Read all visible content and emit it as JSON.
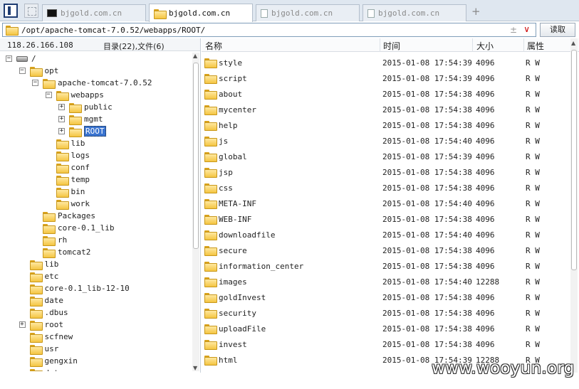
{
  "tabs": [
    {
      "label": "bjgold.com.cn",
      "icon": "terminal-icon",
      "active": false
    },
    {
      "label": "bjgold.com.cn",
      "icon": "folder-icon",
      "active": true
    },
    {
      "label": "bjgold.com.cn",
      "icon": "document-icon",
      "active": false
    },
    {
      "label": "bjgold.com.cn",
      "icon": "document-icon",
      "active": false
    }
  ],
  "new_tab_label": "+",
  "path": {
    "value": "/opt/apache-tomcat-7.0.52/webapps/ROOT/",
    "pin": "±",
    "dropdown": "∨"
  },
  "read_button": "读取",
  "left_panel": {
    "ip": "118.26.166.108",
    "counts": "目录(22),文件(6)"
  },
  "tree": [
    {
      "label": "/",
      "depth": 0,
      "expander": "−",
      "icon": "drive-icon"
    },
    {
      "label": "opt",
      "depth": 1,
      "expander": "−",
      "icon": "folder-icon"
    },
    {
      "label": "apache-tomcat-7.0.52",
      "depth": 2,
      "expander": "−",
      "icon": "folder-icon"
    },
    {
      "label": "webapps",
      "depth": 3,
      "expander": "−",
      "icon": "folder-icon"
    },
    {
      "label": "public",
      "depth": 4,
      "expander": "+",
      "icon": "folder-icon"
    },
    {
      "label": "mgmt",
      "depth": 4,
      "expander": "+",
      "icon": "folder-icon"
    },
    {
      "label": "ROOT",
      "depth": 4,
      "expander": "+",
      "icon": "folder-icon",
      "selected": true
    },
    {
      "label": "lib",
      "depth": 3,
      "expander": "",
      "icon": "folder-icon"
    },
    {
      "label": "logs",
      "depth": 3,
      "expander": "",
      "icon": "folder-icon"
    },
    {
      "label": "conf",
      "depth": 3,
      "expander": "",
      "icon": "folder-icon"
    },
    {
      "label": "temp",
      "depth": 3,
      "expander": "",
      "icon": "folder-icon"
    },
    {
      "label": "bin",
      "depth": 3,
      "expander": "",
      "icon": "folder-icon"
    },
    {
      "label": "work",
      "depth": 3,
      "expander": "",
      "icon": "folder-icon"
    },
    {
      "label": "Packages",
      "depth": 2,
      "expander": "",
      "icon": "folder-icon"
    },
    {
      "label": "core-0.1_lib",
      "depth": 2,
      "expander": "",
      "icon": "folder-icon"
    },
    {
      "label": "rh",
      "depth": 2,
      "expander": "",
      "icon": "folder-icon"
    },
    {
      "label": "tomcat2",
      "depth": 2,
      "expander": "",
      "icon": "folder-icon"
    },
    {
      "label": "lib",
      "depth": 1,
      "expander": "",
      "icon": "folder-icon"
    },
    {
      "label": "etc",
      "depth": 1,
      "expander": "",
      "icon": "folder-icon"
    },
    {
      "label": "core-0.1_lib-12-10",
      "depth": 1,
      "expander": "",
      "icon": "folder-icon"
    },
    {
      "label": "date",
      "depth": 1,
      "expander": "",
      "icon": "folder-icon"
    },
    {
      "label": ".dbus",
      "depth": 1,
      "expander": "",
      "icon": "folder-icon"
    },
    {
      "label": "root",
      "depth": 1,
      "expander": "+",
      "icon": "folder-icon"
    },
    {
      "label": "scfnew",
      "depth": 1,
      "expander": "",
      "icon": "folder-icon"
    },
    {
      "label": "usr",
      "depth": 1,
      "expander": "",
      "icon": "folder-icon"
    },
    {
      "label": "gengxin",
      "depth": 1,
      "expander": "",
      "icon": "folder-icon"
    },
    {
      "label": "data",
      "depth": 1,
      "expander": "",
      "icon": "folder-icon"
    }
  ],
  "columns": {
    "name": "名称",
    "time": "时间",
    "size": "大小",
    "attr": "属性"
  },
  "files": [
    {
      "name": "style",
      "time": "2015-01-08 17:54:39",
      "size": "4096",
      "attr": "R W"
    },
    {
      "name": "script",
      "time": "2015-01-08 17:54:39",
      "size": "4096",
      "attr": "R W"
    },
    {
      "name": "about",
      "time": "2015-01-08 17:54:38",
      "size": "4096",
      "attr": "R W"
    },
    {
      "name": "mycenter",
      "time": "2015-01-08 17:54:38",
      "size": "4096",
      "attr": "R W"
    },
    {
      "name": "help",
      "time": "2015-01-08 17:54:38",
      "size": "4096",
      "attr": "R W"
    },
    {
      "name": "js",
      "time": "2015-01-08 17:54:40",
      "size": "4096",
      "attr": "R W"
    },
    {
      "name": "global",
      "time": "2015-01-08 17:54:39",
      "size": "4096",
      "attr": "R W"
    },
    {
      "name": "jsp",
      "time": "2015-01-08 17:54:38",
      "size": "4096",
      "attr": "R W"
    },
    {
      "name": "css",
      "time": "2015-01-08 17:54:38",
      "size": "4096",
      "attr": "R W"
    },
    {
      "name": "META-INF",
      "time": "2015-01-08 17:54:40",
      "size": "4096",
      "attr": "R W"
    },
    {
      "name": "WEB-INF",
      "time": "2015-01-08 17:54:38",
      "size": "4096",
      "attr": "R W"
    },
    {
      "name": "downloadfile",
      "time": "2015-01-08 17:54:40",
      "size": "4096",
      "attr": "R W"
    },
    {
      "name": "secure",
      "time": "2015-01-08 17:54:38",
      "size": "4096",
      "attr": "R W"
    },
    {
      "name": "information_center",
      "time": "2015-01-08 17:54:38",
      "size": "4096",
      "attr": "R W"
    },
    {
      "name": "images",
      "time": "2015-01-08 17:54:40",
      "size": "12288",
      "attr": "R W"
    },
    {
      "name": "goldInvest",
      "time": "2015-01-08 17:54:38",
      "size": "4096",
      "attr": "R W"
    },
    {
      "name": "security",
      "time": "2015-01-08 17:54:38",
      "size": "4096",
      "attr": "R W"
    },
    {
      "name": "uploadFile",
      "time": "2015-01-08 17:54:38",
      "size": "4096",
      "attr": "R W"
    },
    {
      "name": "invest",
      "time": "2015-01-08 17:54:38",
      "size": "4096",
      "attr": "R W"
    },
    {
      "name": "html",
      "time": "2015-01-08 17:54:39",
      "size": "12288",
      "attr": "R W"
    }
  ],
  "watermark": "www.wooyun.org"
}
